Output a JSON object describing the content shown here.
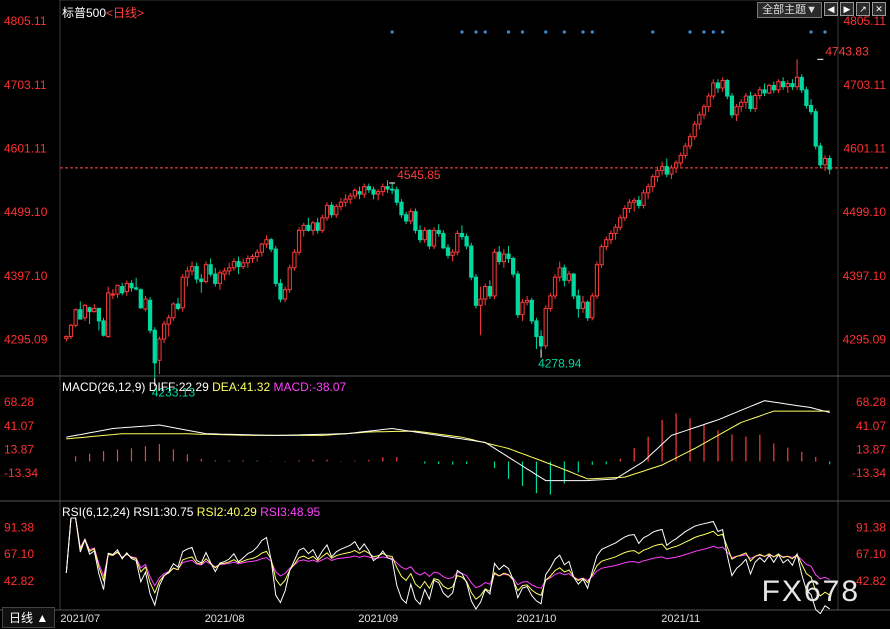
{
  "header": {
    "title": "标普500",
    "period": "<日线>",
    "theme_select": "全部主题▼",
    "icons": [
      "prev-icon",
      "next-icon",
      "export-icon",
      "close-icon"
    ]
  },
  "footer": {
    "period_tab": "日线 ▲",
    "watermark": "FX678"
  },
  "colors": {
    "up": "#ff3b3b",
    "down": "#00d8a0",
    "dif": "#ffffff",
    "dea": "#ffff60",
    "macd": "#ff40ff",
    "rsi1": "#ffffff",
    "rsi2": "#ffff60",
    "rsi3": "#ff40ff",
    "axis_label": "#ff3030",
    "date_label": "#e0e0e0"
  },
  "chart_data": [
    {
      "type": "candlestick",
      "name": "price",
      "ylim": [
        4240,
        4810
      ],
      "y_ticks": [
        "4805.11",
        "4703.11",
        "4601.11",
        "4499.10",
        "4397.10",
        "4295.09"
      ],
      "y_tick_values": [
        4805.11,
        4703.11,
        4601.11,
        4499.1,
        4397.1,
        4295.09
      ],
      "x_ticks": [
        "2021/07",
        "2021/08",
        "2021/09",
        "2021/10",
        "2021/11"
      ],
      "x_tick_index": [
        3,
        34,
        67,
        101,
        132
      ],
      "last_close_line": 4570,
      "annotations": [
        {
          "label": "4233.13",
          "index": 19,
          "value": 4233.13,
          "kind": "low"
        },
        {
          "label": "4545.85",
          "index": 70,
          "value": 4545.85,
          "kind": "high"
        },
        {
          "label": "4278.94",
          "index": 102,
          "value": 4278.94,
          "kind": "low"
        },
        {
          "label": "4743.83",
          "index": 162,
          "value": 4743.83,
          "kind": "high"
        }
      ],
      "event_markers_index": [
        70,
        85,
        88,
        90,
        95,
        98,
        103,
        107,
        111,
        113,
        126,
        134,
        137,
        139,
        141,
        160,
        163
      ],
      "ohlc": [
        [
          4297,
          4302,
          4292,
          4300
        ],
        [
          4300,
          4320,
          4296,
          4318
        ],
        [
          4318,
          4345,
          4315,
          4343
        ],
        [
          4343,
          4356,
          4335,
          4328
        ],
        [
          4330,
          4352,
          4325,
          4350
        ],
        [
          4346,
          4348,
          4320,
          4340
        ],
        [
          4340,
          4352,
          4338,
          4345
        ],
        [
          4345,
          4346,
          4310,
          4325
        ],
        [
          4325,
          4330,
          4300,
          4302
        ],
        [
          4300,
          4380,
          4298,
          4370
        ],
        [
          4368,
          4376,
          4360,
          4368
        ],
        [
          4368,
          4383,
          4362,
          4382
        ],
        [
          4380,
          4386,
          4366,
          4370
        ],
        [
          4372,
          4390,
          4365,
          4385
        ],
        [
          4385,
          4390,
          4372,
          4378
        ],
        [
          4378,
          4394,
          4374,
          4376
        ],
        [
          4375,
          4377,
          4344,
          4346
        ],
        [
          4344,
          4365,
          4340,
          4360
        ],
        [
          4358,
          4363,
          4305,
          4310
        ],
        [
          4310,
          4315,
          4233,
          4258
        ],
        [
          4262,
          4300,
          4240,
          4296
        ],
        [
          4296,
          4325,
          4290,
          4320
        ],
        [
          4320,
          4335,
          4300,
          4330
        ],
        [
          4330,
          4355,
          4325,
          4352
        ],
        [
          4352,
          4362,
          4342,
          4345
        ],
        [
          4346,
          4400,
          4340,
          4395
        ],
        [
          4395,
          4412,
          4380,
          4405
        ],
        [
          4405,
          4420,
          4398,
          4412
        ],
        [
          4412,
          4418,
          4385,
          4392
        ],
        [
          4392,
          4400,
          4370,
          4388
        ],
        [
          4388,
          4420,
          4385,
          4415
        ],
        [
          4415,
          4425,
          4396,
          4400
        ],
        [
          4400,
          4410,
          4380,
          4385
        ],
        [
          4385,
          4406,
          4375,
          4402
        ],
        [
          4400,
          4410,
          4390,
          4405
        ],
        [
          4405,
          4418,
          4398,
          4410
        ],
        [
          4410,
          4425,
          4405,
          4420
        ],
        [
          4420,
          4428,
          4400,
          4412
        ],
        [
          4412,
          4425,
          4408,
          4418
        ],
        [
          4418,
          4430,
          4410,
          4425
        ],
        [
          4425,
          4432,
          4418,
          4428
        ],
        [
          4428,
          4440,
          4420,
          4435
        ],
        [
          4435,
          4450,
          4428,
          4448
        ],
        [
          4448,
          4462,
          4442,
          4455
        ],
        [
          4455,
          4458,
          4435,
          4440
        ],
        [
          4440,
          4445,
          4380,
          4385
        ],
        [
          4385,
          4392,
          4355,
          4360
        ],
        [
          4360,
          4380,
          4355,
          4375
        ],
        [
          4375,
          4415,
          4370,
          4410
        ],
        [
          4410,
          4440,
          4405,
          4435
        ],
        [
          4435,
          4475,
          4430,
          4470
        ],
        [
          4470,
          4482,
          4460,
          4478
        ],
        [
          4478,
          4490,
          4468,
          4470
        ],
        [
          4470,
          4485,
          4462,
          4482
        ],
        [
          4482,
          4490,
          4465,
          4470
        ],
        [
          4470,
          4495,
          4466,
          4490
        ],
        [
          4490,
          4515,
          4485,
          4510
        ],
        [
          4510,
          4515,
          4490,
          4495
        ],
        [
          4495,
          4512,
          4490,
          4508
        ],
        [
          4508,
          4522,
          4502,
          4515
        ],
        [
          4515,
          4528,
          4508,
          4520
        ],
        [
          4520,
          4530,
          4512,
          4525
        ],
        [
          4525,
          4538,
          4520,
          4534
        ],
        [
          4532,
          4540,
          4520,
          4528
        ],
        [
          4528,
          4545,
          4522,
          4540
        ],
        [
          4540,
          4545,
          4530,
          4535
        ],
        [
          4535,
          4540,
          4520,
          4528
        ],
        [
          4528,
          4536,
          4518,
          4532
        ],
        [
          4532,
          4545,
          4525,
          4540
        ],
        [
          4540,
          4550,
          4530,
          4536
        ],
        [
          4536,
          4545,
          4528,
          4535
        ],
        [
          4535,
          4540,
          4510,
          4515
        ],
        [
          4515,
          4520,
          4490,
          4495
        ],
        [
          4495,
          4500,
          4480,
          4485
        ],
        [
          4485,
          4505,
          4480,
          4500
        ],
        [
          4500,
          4505,
          4465,
          4470
        ],
        [
          4470,
          4478,
          4450,
          4455
        ],
        [
          4455,
          4475,
          4450,
          4470
        ],
        [
          4470,
          4472,
          4440,
          4445
        ],
        [
          4445,
          4475,
          4440,
          4470
        ],
        [
          4470,
          4480,
          4460,
          4465
        ],
        [
          4465,
          4470,
          4440,
          4442
        ],
        [
          4442,
          4448,
          4425,
          4430
        ],
        [
          4430,
          4440,
          4420,
          4435
        ],
        [
          4435,
          4470,
          4430,
          4465
        ],
        [
          4465,
          4478,
          4455,
          4460
        ],
        [
          4460,
          4465,
          4440,
          4445
        ],
        [
          4445,
          4450,
          4390,
          4395
        ],
        [
          4395,
          4400,
          4345,
          4350
        ],
        [
          4350,
          4380,
          4302,
          4360
        ],
        [
          4360,
          4385,
          4350,
          4380
        ],
        [
          4380,
          4390,
          4360,
          4365
        ],
        [
          4365,
          4440,
          4360,
          4435
        ],
        [
          4435,
          4445,
          4415,
          4420
        ],
        [
          4420,
          4440,
          4410,
          4432
        ],
        [
          4432,
          4445,
          4418,
          4425
        ],
        [
          4425,
          4428,
          4395,
          4400
        ],
        [
          4400,
          4405,
          4330,
          4335
        ],
        [
          4335,
          4360,
          4325,
          4355
        ],
        [
          4355,
          4365,
          4350,
          4358
        ],
        [
          4358,
          4362,
          4320,
          4325
        ],
        [
          4325,
          4330,
          4280,
          4300
        ],
        [
          4300,
          4310,
          4278,
          4285
        ],
        [
          4285,
          4350,
          4280,
          4345
        ],
        [
          4345,
          4370,
          4340,
          4365
        ],
        [
          4365,
          4400,
          4360,
          4395
        ],
        [
          4395,
          4420,
          4388,
          4410
        ],
        [
          4410,
          4415,
          4380,
          4390
        ],
        [
          4390,
          4405,
          4385,
          4400
        ],
        [
          4400,
          4402,
          4360,
          4365
        ],
        [
          4365,
          4375,
          4330,
          4345
        ],
        [
          4345,
          4365,
          4338,
          4355
        ],
        [
          4355,
          4358,
          4325,
          4330
        ],
        [
          4330,
          4370,
          4326,
          4365
        ],
        [
          4365,
          4420,
          4360,
          4415
        ],
        [
          4415,
          4448,
          4410,
          4444
        ],
        [
          4444,
          4460,
          4438,
          4455
        ],
        [
          4455,
          4470,
          4448,
          4465
        ],
        [
          4465,
          4480,
          4455,
          4475
        ],
        [
          4475,
          4495,
          4470,
          4490
        ],
        [
          4490,
          4510,
          4485,
          4505
        ],
        [
          4505,
          4520,
          4498,
          4515
        ],
        [
          4515,
          4522,
          4500,
          4518
        ],
        [
          4518,
          4525,
          4505,
          4510
        ],
        [
          4510,
          4535,
          4505,
          4530
        ],
        [
          4530,
          4545,
          4520,
          4540
        ],
        [
          4540,
          4560,
          4532,
          4556
        ],
        [
          4556,
          4572,
          4548,
          4566
        ],
        [
          4566,
          4580,
          4558,
          4572
        ],
        [
          4572,
          4585,
          4555,
          4560
        ],
        [
          4560,
          4575,
          4552,
          4570
        ],
        [
          4570,
          4582,
          4562,
          4578
        ],
        [
          4578,
          4595,
          4572,
          4590
        ],
        [
          4590,
          4610,
          4585,
          4605
        ],
        [
          4605,
          4625,
          4600,
          4620
        ],
        [
          4620,
          4645,
          4615,
          4640
        ],
        [
          4640,
          4660,
          4632,
          4655
        ],
        [
          4655,
          4672,
          4648,
          4668
        ],
        [
          4668,
          4690,
          4660,
          4685
        ],
        [
          4685,
          4712,
          4680,
          4706
        ],
        [
          4706,
          4712,
          4690,
          4698
        ],
        [
          4698,
          4715,
          4692,
          4710
        ],
        [
          4710,
          4712,
          4680,
          4685
        ],
        [
          4685,
          4690,
          4650,
          4655
        ],
        [
          4655,
          4672,
          4645,
          4668
        ],
        [
          4668,
          4680,
          4660,
          4675
        ],
        [
          4675,
          4690,
          4665,
          4685
        ],
        [
          4685,
          4692,
          4660,
          4665
        ],
        [
          4665,
          4690,
          4660,
          4686
        ],
        [
          4686,
          4700,
          4680,
          4695
        ],
        [
          4695,
          4705,
          4685,
          4690
        ],
        [
          4690,
          4705,
          4688,
          4702
        ],
        [
          4702,
          4708,
          4690,
          4695
        ],
        [
          4695,
          4712,
          4690,
          4708
        ],
        [
          4708,
          4715,
          4695,
          4700
        ],
        [
          4700,
          4710,
          4690,
          4705
        ],
        [
          4705,
          4712,
          4695,
          4700
        ],
        [
          4700,
          4744,
          4695,
          4715
        ],
        [
          4715,
          4720,
          4690,
          4695
        ],
        [
          4695,
          4700,
          4665,
          4670
        ],
        [
          4670,
          4680,
          4655,
          4660
        ],
        [
          4660,
          4665,
          4600,
          4605
        ],
        [
          4605,
          4610,
          4570,
          4575
        ],
        [
          4575,
          4590,
          4565,
          4585
        ],
        [
          4585,
          4590,
          4560,
          4568
        ]
      ]
    },
    {
      "type": "line",
      "name": "macd",
      "title": "MACD(26,12,9)",
      "legend": [
        {
          "label": "DIFF:22.29",
          "color": "#ffffff"
        },
        {
          "label": "DEA:41.32",
          "color": "#ffff60"
        },
        {
          "label": "MACD:-38.07",
          "color": "#ff40ff"
        }
      ],
      "ylim": [
        -42,
        80
      ],
      "y_ticks": [
        "68.28",
        "41.07",
        "13.87",
        "-13.34"
      ],
      "y_tick_values": [
        68.28,
        41.07,
        13.87,
        -13.34
      ],
      "dif_keys": [
        [
          0,
          28
        ],
        [
          10,
          38
        ],
        [
          20,
          42
        ],
        [
          30,
          32
        ],
        [
          45,
          30
        ],
        [
          60,
          32
        ],
        [
          70,
          38
        ],
        [
          80,
          30
        ],
        [
          90,
          22
        ],
        [
          95,
          5
        ],
        [
          103,
          -22
        ],
        [
          112,
          -22
        ],
        [
          118,
          -20
        ],
        [
          124,
          0
        ],
        [
          130,
          30
        ],
        [
          140,
          48
        ],
        [
          150,
          70
        ],
        [
          160,
          62
        ],
        [
          170,
          48
        ],
        [
          177,
          22
        ]
      ],
      "dea_keys": [
        [
          0,
          26
        ],
        [
          12,
          32
        ],
        [
          25,
          32
        ],
        [
          40,
          30
        ],
        [
          55,
          30
        ],
        [
          65,
          34
        ],
        [
          75,
          35
        ],
        [
          85,
          28
        ],
        [
          95,
          15
        ],
        [
          105,
          -5
        ],
        [
          112,
          -20
        ],
        [
          120,
          -18
        ],
        [
          128,
          -4
        ],
        [
          135,
          15
        ],
        [
          145,
          45
        ],
        [
          152,
          58
        ],
        [
          165,
          58
        ],
        [
          177,
          41
        ]
      ]
    },
    {
      "type": "line",
      "name": "rsi",
      "title": "RSI(6,12,24)",
      "legend": [
        {
          "label": "RSI1:30.75",
          "color": "#ffffff"
        },
        {
          "label": "RSI2:40.29",
          "color": "#ffff60"
        },
        {
          "label": "RSI3:48.95",
          "color": "#ff40ff"
        }
      ],
      "ylim": [
        18,
        100
      ],
      "y_ticks": [
        "91.38",
        "67.10",
        "42.82"
      ],
      "y_tick_values": [
        91.38,
        67.1,
        42.82
      ]
    }
  ]
}
